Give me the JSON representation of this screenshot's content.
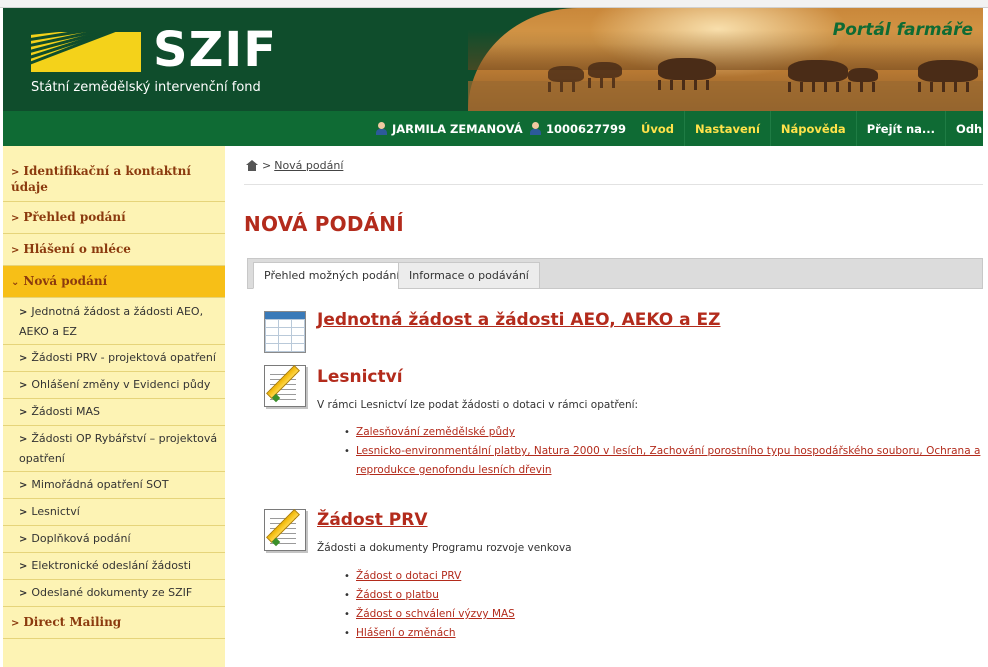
{
  "header": {
    "logo_text": "SZIF",
    "logo_subtitle": "Státní zemědělský intervenční fond",
    "portal_title": "Portál farmáře"
  },
  "navbar": {
    "user_name": "JARMILA ZEMANOVÁ",
    "user_id": "1000627799",
    "items": [
      {
        "label": "Úvod"
      },
      {
        "label": "Nastavení"
      },
      {
        "label": "Nápověda"
      },
      {
        "label": "Přejít na..."
      },
      {
        "label": "Odhlásit"
      }
    ]
  },
  "sidebar": {
    "items": [
      {
        "label": "Identifikační a kontaktní údaje"
      },
      {
        "label": "Přehled podání"
      },
      {
        "label": "Hlášení o mléce"
      },
      {
        "label": "Nová podání"
      }
    ],
    "subitems": [
      {
        "label": "Jednotná žádost a žádosti AEO, AEKO a EZ"
      },
      {
        "label": "Žádosti PRV - projektová opatření"
      },
      {
        "label": "Ohlášení změny v Evidenci půdy"
      },
      {
        "label": "Žádosti MAS"
      },
      {
        "label": "Žádosti OP Rybářství – projektová opatření"
      },
      {
        "label": "Mimořádná opatření SOT"
      },
      {
        "label": "Lesnictví"
      },
      {
        "label": "Doplňková podání"
      },
      {
        "label": "Elektronické odeslání žádosti"
      },
      {
        "label": "Odeslané dokumenty ze SZIF"
      }
    ],
    "last_item": {
      "label": "Direct Mailing"
    }
  },
  "breadcrumb": {
    "separator": ">",
    "current": "Nová podání"
  },
  "main": {
    "page_title": "NOVÁ PODÁNÍ",
    "tabs": [
      {
        "label": "Přehled možných podání"
      },
      {
        "label": "Informace o podávání"
      }
    ],
    "sections": [
      {
        "title": "Jednotná žádost a žádosti AEO, AEKO a EZ",
        "icon": "table-icon"
      },
      {
        "title": "Lesnictví",
        "icon": "document-pencil-icon",
        "description": "V rámci Lesnictví lze podat žádosti o dotaci v rámci opatření:",
        "links": [
          "Zalesňování zemědělské půdy",
          "Lesnicko-environmentální platby, Natura 2000 v lesích, Zachování porostního typu hospodářského souboru, Ochrana a",
          "reprodukce genofondu lesních dřevin"
        ]
      },
      {
        "title": "Žádost PRV",
        "icon": "document-pencil-icon",
        "description": "Žádosti a dokumenty Programu rozvoje venkova",
        "links": [
          "Žádost o dotaci PRV",
          "Žádost o platbu",
          "Žádost o schválení výzvy MAS",
          "Hlášení o změnách"
        ]
      }
    ]
  },
  "colors": {
    "brand_dark_green": "#0f4d2c",
    "nav_green": "#0f6b34",
    "nav_link_yellow": "#ffe24a",
    "sidebar_bg": "#fdf3b4",
    "sidebar_active": "#f7bf17",
    "title_red": "#b32b1c"
  }
}
